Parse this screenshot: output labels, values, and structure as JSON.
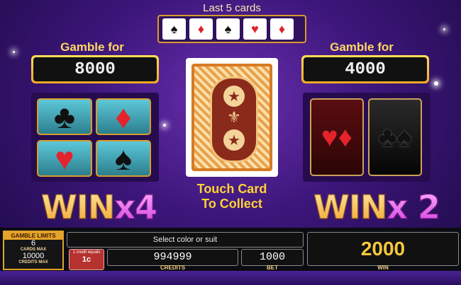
{
  "last_cards": {
    "title": "Last 5 cards",
    "cards": [
      {
        "suit": "♠",
        "color": "black"
      },
      {
        "suit": "♦",
        "color": "red"
      },
      {
        "suit": "♠",
        "color": "black"
      },
      {
        "suit": "♥",
        "color": "red"
      },
      {
        "suit": "♦",
        "color": "red"
      }
    ]
  },
  "left": {
    "gamble_label": "Gamble for",
    "gamble_amount": "8000",
    "win_text": "WIN",
    "multiplier": "x4",
    "suits": [
      {
        "name": "clubs-icon",
        "glyph": "♣",
        "color": "black"
      },
      {
        "name": "diamonds-icon",
        "glyph": "♦",
        "color": "red"
      },
      {
        "name": "hearts-icon",
        "glyph": "♥",
        "color": "red"
      },
      {
        "name": "spades-icon",
        "glyph": "♠",
        "color": "black"
      }
    ]
  },
  "right": {
    "gamble_label": "Gamble for",
    "gamble_amount": "4000",
    "win_text": "WIN",
    "multiplier": "x 2",
    "colors": [
      {
        "name": "red-color-icon",
        "glyph": "♥♦"
      },
      {
        "name": "black-color-icon",
        "glyph": "♣♠"
      }
    ]
  },
  "center": {
    "collect_line1": "Touch Card",
    "collect_line2": "To Collect"
  },
  "bottom": {
    "limits_header": "GAMBLE LIMITS",
    "cards_max_value": "6",
    "cards_max_label": "CARDS MAX",
    "credits_max_value": "10000",
    "credits_max_label": "CREDITS MAX",
    "message": "Select color or suit",
    "credit_equals": "1 credit equals",
    "credit_value": "1c",
    "credits": "994999",
    "credits_label": "CREDITS",
    "bet": "1000",
    "bet_label": "BET",
    "win": "2000",
    "win_label": "WIN"
  },
  "colors": {
    "accent_gold": "#f2a922",
    "background_purple": "#3c167a",
    "win_pink": "#d23be0"
  }
}
